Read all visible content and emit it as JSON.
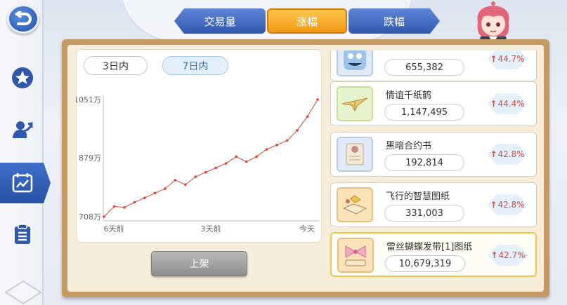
{
  "tabs": {
    "volume": "交易量",
    "rise": "涨幅",
    "fall": "跌幅"
  },
  "period": {
    "three_days": "3日内",
    "seven_days": "7日内"
  },
  "chart_data": {
    "type": "line",
    "x_labels": [
      "6天前",
      "3天前",
      "今天"
    ],
    "y_labels": [
      "1051万",
      "879万",
      "708万"
    ],
    "ylim": [
      708,
      1051
    ],
    "unit": "万",
    "values": [
      708,
      738,
      735,
      750,
      763,
      777,
      790,
      815,
      802,
      825,
      838,
      851,
      864,
      884,
      869,
      884,
      905,
      918,
      931,
      961,
      1001,
      1051
    ],
    "color": "#d9473b",
    "grid": false
  },
  "listing_button": "上架",
  "items": [
    {
      "name": "",
      "price": "655,382",
      "change": "44.7%",
      "thumb": "blue-creature"
    },
    {
      "name": "情谊千纸鹤",
      "price": "1,147,495",
      "change": "44.4%",
      "thumb": "paper-crane"
    },
    {
      "name": "黑暗合约书",
      "price": "192,814",
      "change": "42.8%",
      "thumb": "scroll"
    },
    {
      "name": "飞行的智慧图纸",
      "price": "331,003",
      "change": "42.8%",
      "thumb": "blueprint"
    },
    {
      "name": "雷丝蝴蝶发带[1]图纸",
      "price": "10,679,319",
      "change": "42.7%",
      "thumb": "bow-blueprint"
    }
  ],
  "colors": {
    "accent_blue": "#2f58ad",
    "tab_active": "#f29a17",
    "up_red": "#d94a3a"
  }
}
